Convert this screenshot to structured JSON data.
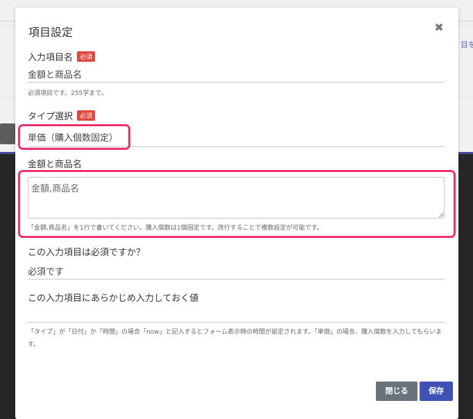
{
  "background": {
    "link_fragment": "目を"
  },
  "modal": {
    "title": "項目設定",
    "close_icon": "close-icon"
  },
  "item_name": {
    "label": "入力項目名",
    "required_badge": "必須",
    "value": "金額と商品名",
    "help": "必須項目です。255字まで。"
  },
  "type_select": {
    "label": "タイプ選択",
    "required_badge": "必須",
    "value": "単価（購入個数固定）"
  },
  "product_section": {
    "label": "金額と商品名",
    "textarea_value": "金額,商品名",
    "help": "「金額,商品名」を1行で書いてください。購入個数は1個固定です。改行することで複数設定が可能です。"
  },
  "required_question": {
    "label": "この入力項目は必須ですか？",
    "value": "必須です"
  },
  "default_value": {
    "label": "この入力項目にあらかじめ入力しておく値",
    "value": "",
    "help": "「タイプ」が「日付」か「時間」の場合「now」と記入するとフォーム表示時の時間が設定されます。「単価」の場合、購入個数を入力してもらいます。"
  },
  "buttons": {
    "close_label": "閉じる",
    "save_label": "保存"
  },
  "colors": {
    "highlight": "#f0306a",
    "badge": "#e2453c",
    "save_button": "#3f51b5",
    "close_button": "#6a737b"
  }
}
